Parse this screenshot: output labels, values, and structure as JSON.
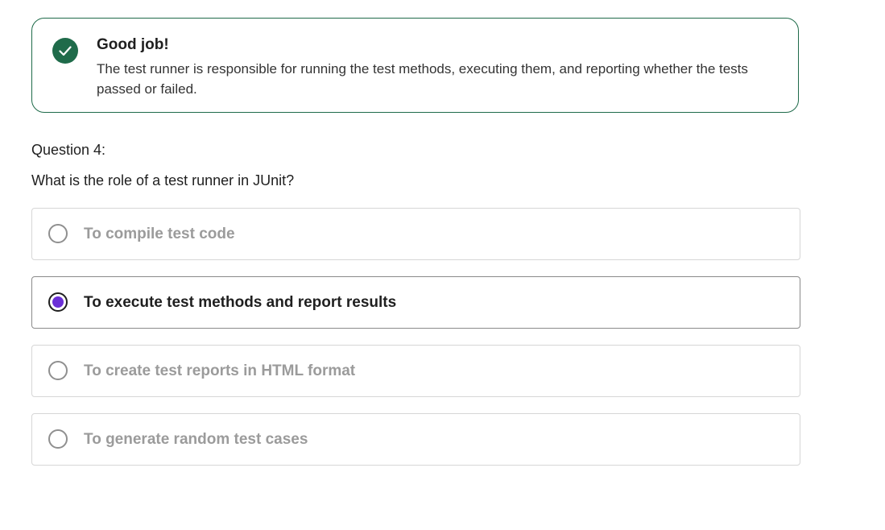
{
  "feedback": {
    "icon": "checkmark-circle-icon",
    "title": "Good job!",
    "text": "The test runner is responsible for running the test methods, executing them, and reporting whether the tests passed or failed.",
    "color": "#1f6b4a"
  },
  "question": {
    "label": "Question 4:",
    "text": "What is the role of a test runner in JUnit?"
  },
  "options": [
    {
      "label": "To compile test code",
      "selected": false
    },
    {
      "label": "To execute test methods and report results",
      "selected": true
    },
    {
      "label": "To create test reports in HTML format",
      "selected": false
    },
    {
      "label": "To generate random test cases",
      "selected": false
    }
  ],
  "colors": {
    "selected_radio": "#6b2fd6",
    "muted_text": "#9b9b9b"
  }
}
